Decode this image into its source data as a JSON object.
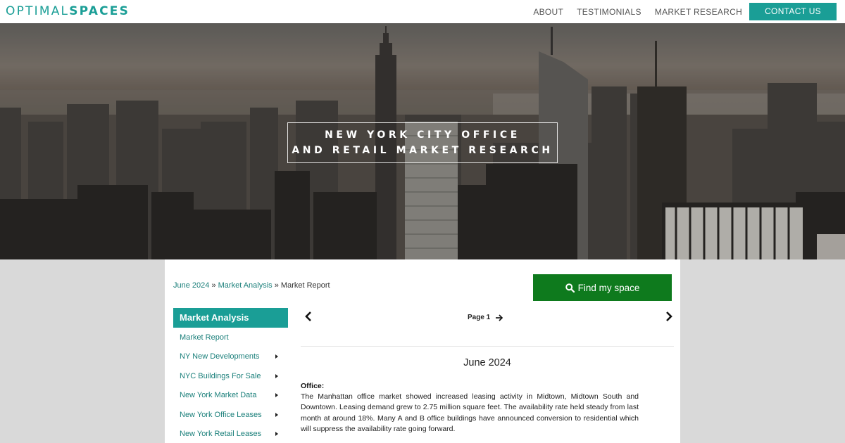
{
  "header": {
    "logo_light": "OPTIMAL",
    "logo_bold": "SPACES",
    "nav": [
      "ABOUT",
      "TESTIMONIALS",
      "MARKET RESEARCH"
    ],
    "contact_label": "CONTACT US"
  },
  "hero": {
    "line1": "NEW YORK CITY OFFICE",
    "line2": "AND RETAIL MARKET RESEARCH"
  },
  "breadcrumb": {
    "item1": "June 2024",
    "sep": "»",
    "item2": "Market Analysis",
    "current": "Market Report"
  },
  "find_button": {
    "label": "Find my space",
    "icon": "search-icon"
  },
  "sidebar": {
    "heading": "Market Analysis",
    "items": [
      {
        "label": "Market Report",
        "has_arrow": false
      },
      {
        "label": "NY New Developments",
        "has_arrow": true
      },
      {
        "label": "NYC Buildings For Sale",
        "has_arrow": true
      },
      {
        "label": "New York Market Data",
        "has_arrow": true
      },
      {
        "label": "New York Office Leases",
        "has_arrow": true
      },
      {
        "label": "New York Retail Leases",
        "has_arrow": true
      }
    ]
  },
  "pager": {
    "label": "Page 1",
    "prev_icon": "chevron-left-icon",
    "next_icon": "chevron-right-icon",
    "page_arrow_icon": "arrow-right-icon"
  },
  "report": {
    "title": "June 2024",
    "section": "Office:",
    "body": "The Manhattan office market showed increased leasing activity in Midtown, Midtown South and Downtown. Leasing demand grew to 2.75 million square feet. The availability rate held steady from last month at around 18%. Many A and B office buildings have announced conversion to residential which will suppress the availability rate going forward."
  },
  "colors": {
    "accent": "#1a9e96",
    "find_button": "#0e7a1d",
    "link": "#1a7f7a"
  }
}
